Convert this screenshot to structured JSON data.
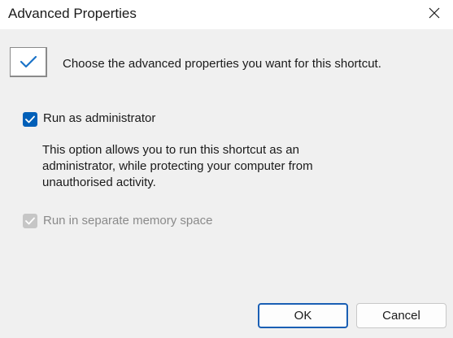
{
  "window": {
    "title": "Advanced Properties",
    "close_icon": "close-icon"
  },
  "header": {
    "icon": "checkmark-box-icon",
    "text": "Choose the advanced properties you want for this shortcut."
  },
  "options": {
    "run_as_admin": {
      "label": "Run as administrator",
      "checked": true,
      "enabled": true,
      "description": "This option allows you to run this shortcut as an administrator, while protecting your computer from unauthorised activity."
    },
    "separate_memory": {
      "label": "Run in separate memory space",
      "checked": true,
      "enabled": false
    }
  },
  "buttons": {
    "ok_label": "OK",
    "cancel_label": "Cancel"
  },
  "colors": {
    "accent": "#005fb8",
    "disabled": "#c6c6c6",
    "background": "#f0f0f0"
  }
}
